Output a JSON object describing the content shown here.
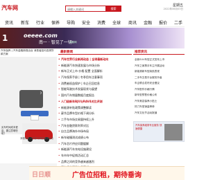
{
  "header": {
    "logo": "汽车网",
    "search_placeholder": "请输入关键词",
    "search_button": "搜索",
    "city": "星期五",
    "date": "2022年06月03日"
  },
  "nav": [
    "资讯",
    "新车",
    "行业",
    "保养",
    "导购",
    "安全",
    "消费",
    "全球",
    "商讯",
    "金融",
    "报价",
    "二手"
  ],
  "banner": {
    "number": "1",
    "brand": "oeeee.com",
    "slogan": "南一 · 智见了一切",
    "sub": "南都网"
  },
  "left": {
    "caption": "汽车保养 | 汽车金融新规出台 消费者如何选择贷款方案",
    "photo_text": "买车时间成本更高，要注意哪些呢？",
    "car_caption": "奔驰车队人员参与调查保障活动"
  },
  "middle": {
    "header": "最新要闻",
    "items": [
      {
        "text": "汽车世界行业新闻动态 | 全球最新动向",
        "bold": true
      },
      {
        "text": "新能源汽车快速发展与市场分析",
        "bold": false
      },
      {
        "text": "新车正式上市 价格 配置 全面解析",
        "bold": false
      },
      {
        "text": "汽车保养手册 | 冬季用车注意事项",
        "bold": false
      },
      {
        "text": "消费者权益保护 | 车企召回信息",
        "bold": false
      },
      {
        "text": "智能驾驶技术发展现状与展望",
        "bold": false
      },
      {
        "text": "国内汽车销量数据月度报告",
        "bold": false
      },
      {
        "text": "人门级新车BJU与RAV4对比评测",
        "bold": true
      },
      {
        "text": "新能源补贴政策调整解读",
        "bold": false
      },
      {
        "text": "豪华品牌车型价格下调分析",
        "bold": false
      },
      {
        "text": "二手车市场交易量持续上升",
        "bold": false
      },
      {
        "text": "汽车金融贷款利率对比",
        "bold": false
      },
      {
        "text": "自主品牌海外市场布局",
        "bold": false
      },
      {
        "text": "新车碰撞测试成绩公布",
        "bold": false
      },
      {
        "text": "汽车芯片供应问题缓解",
        "bold": false
      },
      {
        "text": "新能源汽车充电设施建设",
        "bold": false
      },
      {
        "text": "车市年中促销活动汇总",
        "bold": false
      },
      {
        "text": "品牌之间的竞争越来越激烈",
        "bold": false
      },
      {
        "text": "汽车行业资讯每日更新",
        "bold": false
      }
    ]
  },
  "right": {
    "header": "推荐资讯",
    "items": [
      "全新SUV车型正式发布上市",
      "汽车之家携手车主开展活动",
      "新能源新车型续航表现",
      "二手车交易平台服务升级",
      "车企联合发布安全倡议",
      "汽车配件价格行情",
      "新车型预售价格公布",
      "汽车美容保养小贴士",
      "热门车型销量榜单",
      "汽车文化节活动报道"
    ],
    "ad_text": "汽车保养维修专业服务 快速便捷"
  },
  "bottom_ad": {
    "left": "日日顺",
    "main": "广告位招租，期待垂询"
  },
  "colors": {
    "accent": "#c8161d"
  }
}
